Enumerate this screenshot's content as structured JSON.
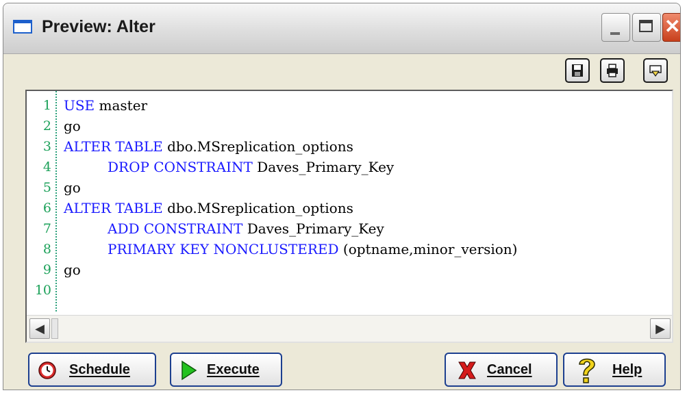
{
  "window": {
    "title": "Preview: Alter"
  },
  "titlebar_buttons": {
    "minimize": "minimize-button",
    "maximize": "maximize-button",
    "close": "✕"
  },
  "toolbar": [
    "save-icon",
    "print-icon",
    "export-icon"
  ],
  "editor": {
    "lines": [
      {
        "n": "1",
        "indent": 0,
        "parts": [
          {
            "t": "USE",
            "kw": true
          },
          {
            "t": " master",
            "kw": false
          }
        ]
      },
      {
        "n": "2",
        "indent": 0,
        "parts": [
          {
            "t": "go",
            "kw": false
          }
        ]
      },
      {
        "n": "3",
        "indent": 0,
        "parts": [
          {
            "t": "ALTER TABLE",
            "kw": true
          },
          {
            "t": " dbo.MSreplication_options",
            "kw": false
          }
        ]
      },
      {
        "n": "4",
        "indent": 1,
        "parts": [
          {
            "t": "DROP CONSTRAINT",
            "kw": true
          },
          {
            "t": " Daves_Primary_Key",
            "kw": false
          }
        ]
      },
      {
        "n": "5",
        "indent": 0,
        "parts": [
          {
            "t": "go",
            "kw": false
          }
        ]
      },
      {
        "n": "6",
        "indent": 0,
        "parts": [
          {
            "t": "ALTER TABLE",
            "kw": true
          },
          {
            "t": " dbo.MSreplication_options",
            "kw": false
          }
        ]
      },
      {
        "n": "7",
        "indent": 1,
        "parts": [
          {
            "t": "ADD CONSTRAINT",
            "kw": true
          },
          {
            "t": " Daves_Primary_Key",
            "kw": false
          }
        ]
      },
      {
        "n": "8",
        "indent": 1,
        "parts": [
          {
            "t": "PRIMARY KEY NONCLUSTERED",
            "kw": true
          },
          {
            "t": " (optname,minor_version)",
            "kw": false
          }
        ]
      },
      {
        "n": "9",
        "indent": 0,
        "parts": [
          {
            "t": "go",
            "kw": false
          }
        ]
      },
      {
        "n": "10",
        "indent": 0,
        "parts": []
      }
    ],
    "keyword_color": "#1a1aff",
    "line_number_color": "#1aa058"
  },
  "buttons": {
    "schedule": "Schedule",
    "execute": "Execute",
    "cancel": "Cancel",
    "help": "Help"
  },
  "colors": {
    "accent": "#1c3f8f",
    "close_red": "#c8401c"
  }
}
